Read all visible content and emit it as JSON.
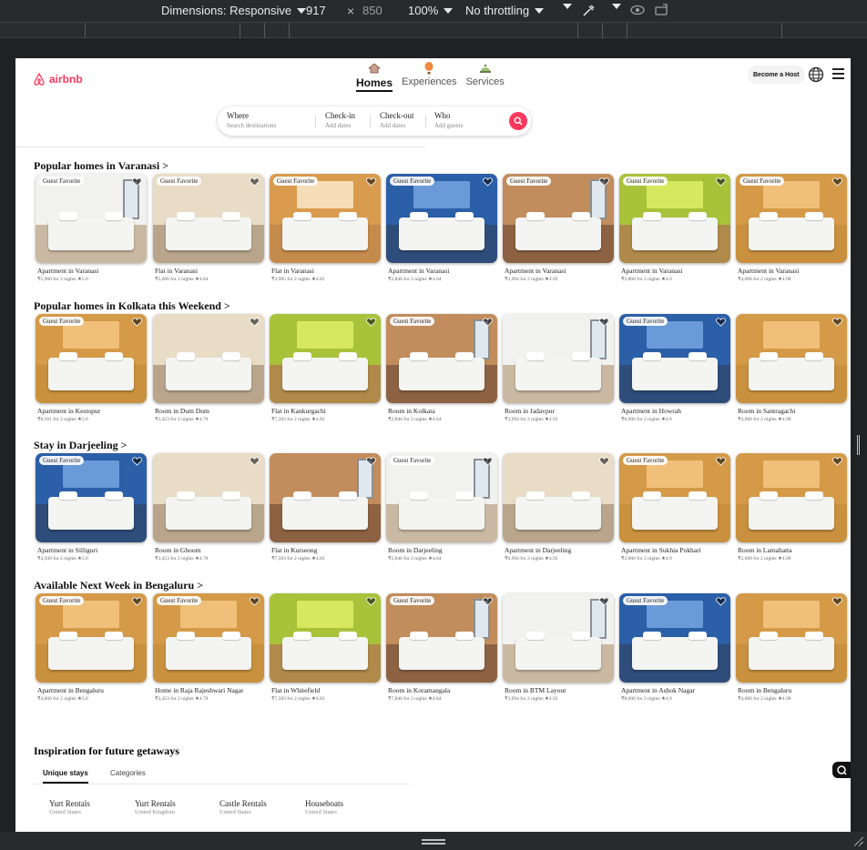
{
  "devtools": {
    "dimensions_label": "Dimensions: Responsive",
    "width": "917",
    "times": "×",
    "height": "850",
    "zoom": "100%",
    "throttling": "No throttling"
  },
  "header": {
    "logo_text": "airbnb",
    "nav": [
      {
        "label": "Homes",
        "icon": "house-icon"
      },
      {
        "label": "Experiences",
        "icon": "balloon-icon"
      },
      {
        "label": "Services",
        "icon": "bell-icon"
      }
    ],
    "host_label": "Become a Host"
  },
  "search": {
    "where_title": "Where",
    "where_sub": "Search destinations",
    "checkin_title": "Check-in",
    "checkin_sub": "Add dates",
    "checkout_title": "Check-out",
    "checkout_sub": "Add dates",
    "who_title": "Who",
    "who_sub": "Add guests"
  },
  "sections": [
    {
      "title": "Popular homes in Varanasi >",
      "cards": [
        {
          "badge": "Guest Favorite",
          "title": "Apartment in Varanasi",
          "price": "₹5,960 for 2 nights ★5.0"
        },
        {
          "badge": "Guest Favorite",
          "title": "Flat in Varanasi",
          "price": "₹5,000 for 2 nights ★4.64"
        },
        {
          "badge": "Guest Favorite",
          "title": "Flat in Varanasi",
          "price": "₹3,985 for 2 nights ★4.82"
        },
        {
          "badge": "Guest Favorite",
          "title": "Apartment in Varanasi",
          "price": "₹2,846 for 2 nights ★4.64"
        },
        {
          "badge": "Guest Favorite",
          "title": "Apartment in Varanasi",
          "price": "₹3,994 for 2 nights ★4.92"
        },
        {
          "badge": "Guest Favorite",
          "title": "Apartment in Varanasi",
          "price": "₹3,868 for 2 nights ★4.9"
        },
        {
          "badge": "Guest Favorite",
          "title": "Apartment in Varanasi",
          "price": "₹4,000 for 2 nights ★4.98"
        }
      ]
    },
    {
      "title": "Popular homes in Kolkata this Weekend >",
      "cards": [
        {
          "badge": "Guest Favorite",
          "title": "Apartment in Kestopur",
          "price": "₹8,561 for 2 nights ★5.0"
        },
        {
          "badge": "",
          "title": "Room in Dum Dum",
          "price": "₹3,453 for 2 nights ★4.78"
        },
        {
          "badge": "",
          "title": "Flat in Kankurgachi",
          "price": "₹7,583 for 2 nights ★4.82"
        },
        {
          "badge": "Guest Favorite",
          "title": "Room in Kolkata",
          "price": "₹2,846 for 2 nights ★4.64"
        },
        {
          "badge": "",
          "title": "Room in Jadavpur",
          "price": "₹3,994 for 2 nights ★4.92"
        },
        {
          "badge": "Guest Favorite",
          "title": "Apartment in Howrah",
          "price": "₹6,000 for 2 nights ★4.9"
        },
        {
          "badge": "",
          "title": "Room in Santragachi",
          "price": "₹4,000 for 2 nights ★4.98"
        }
      ]
    },
    {
      "title": "Stay in Darjeeling >",
      "cards": [
        {
          "badge": "Guest Favorite",
          "title": "Apartment in Silliguri",
          "price": "₹4,500 for 2 nights ★5.0"
        },
        {
          "badge": "",
          "title": "Room in Ghoom",
          "price": "₹3,453 for 2 nights ★4.78"
        },
        {
          "badge": "",
          "title": "Flat in Kurseong",
          "price": "₹7,583 for 2 nights ★4.82"
        },
        {
          "badge": "Guest Favorite",
          "title": "Room in Darjeeling",
          "price": "₹5,846 for 2 nights ★4.64"
        },
        {
          "badge": "",
          "title": "Apartment in Darjeeling",
          "price": "₹6,994 for 2 nights ★4.92"
        },
        {
          "badge": "Guest Favorite",
          "title": "Apartment in Sukhia Pokhari",
          "price": "₹2,000 for 2 nights ★4.9"
        },
        {
          "badge": "",
          "title": "Room in Lamahatta",
          "price": "₹2,000 for 2 nights ★4.98"
        }
      ]
    },
    {
      "title": "Available Next Week in Bengaluru >",
      "cards": [
        {
          "badge": "Guest Favorite",
          "title": "Apartment in Bengaluru",
          "price": "₹4,000 for 2 nights ★5.0"
        },
        {
          "badge": "Guest Favorite",
          "title": "Home in Raja Rajeshwari Nagar",
          "price": "₹3,453 for 2 nights ★4.78"
        },
        {
          "badge": "",
          "title": "Flat in Whitefield",
          "price": "₹7,583 for 2 nights ★4.82"
        },
        {
          "badge": "Guest Favorite",
          "title": "Room in Koramangala",
          "price": "₹7,846 for 2 nights ★4.64"
        },
        {
          "badge": "",
          "title": "Room in BTM Layout",
          "price": "₹3,994 for 2 nights ★4.92"
        },
        {
          "badge": "Guest Favorite",
          "title": "Apartment in Ashok Nagar",
          "price": "₹8,000 for 2 nights ★4.9"
        },
        {
          "badge": "",
          "title": "Room in Bengaluru",
          "price": "₹4,000 for 2 nights ★4.98"
        }
      ]
    }
  ],
  "inspiration": {
    "title": "Inspiration for future getaways",
    "tabs": [
      "Unique stays",
      "Categories"
    ],
    "destinations": [
      {
        "name": "Yurt Rentals",
        "country": "United States"
      },
      {
        "name": "Yurt Rentals",
        "country": "United Kingdom"
      },
      {
        "name": "Castle Rentals",
        "country": "United States"
      },
      {
        "name": "Houseboats",
        "country": "United States"
      }
    ]
  },
  "colors": {
    "brand": "#ff385c"
  }
}
